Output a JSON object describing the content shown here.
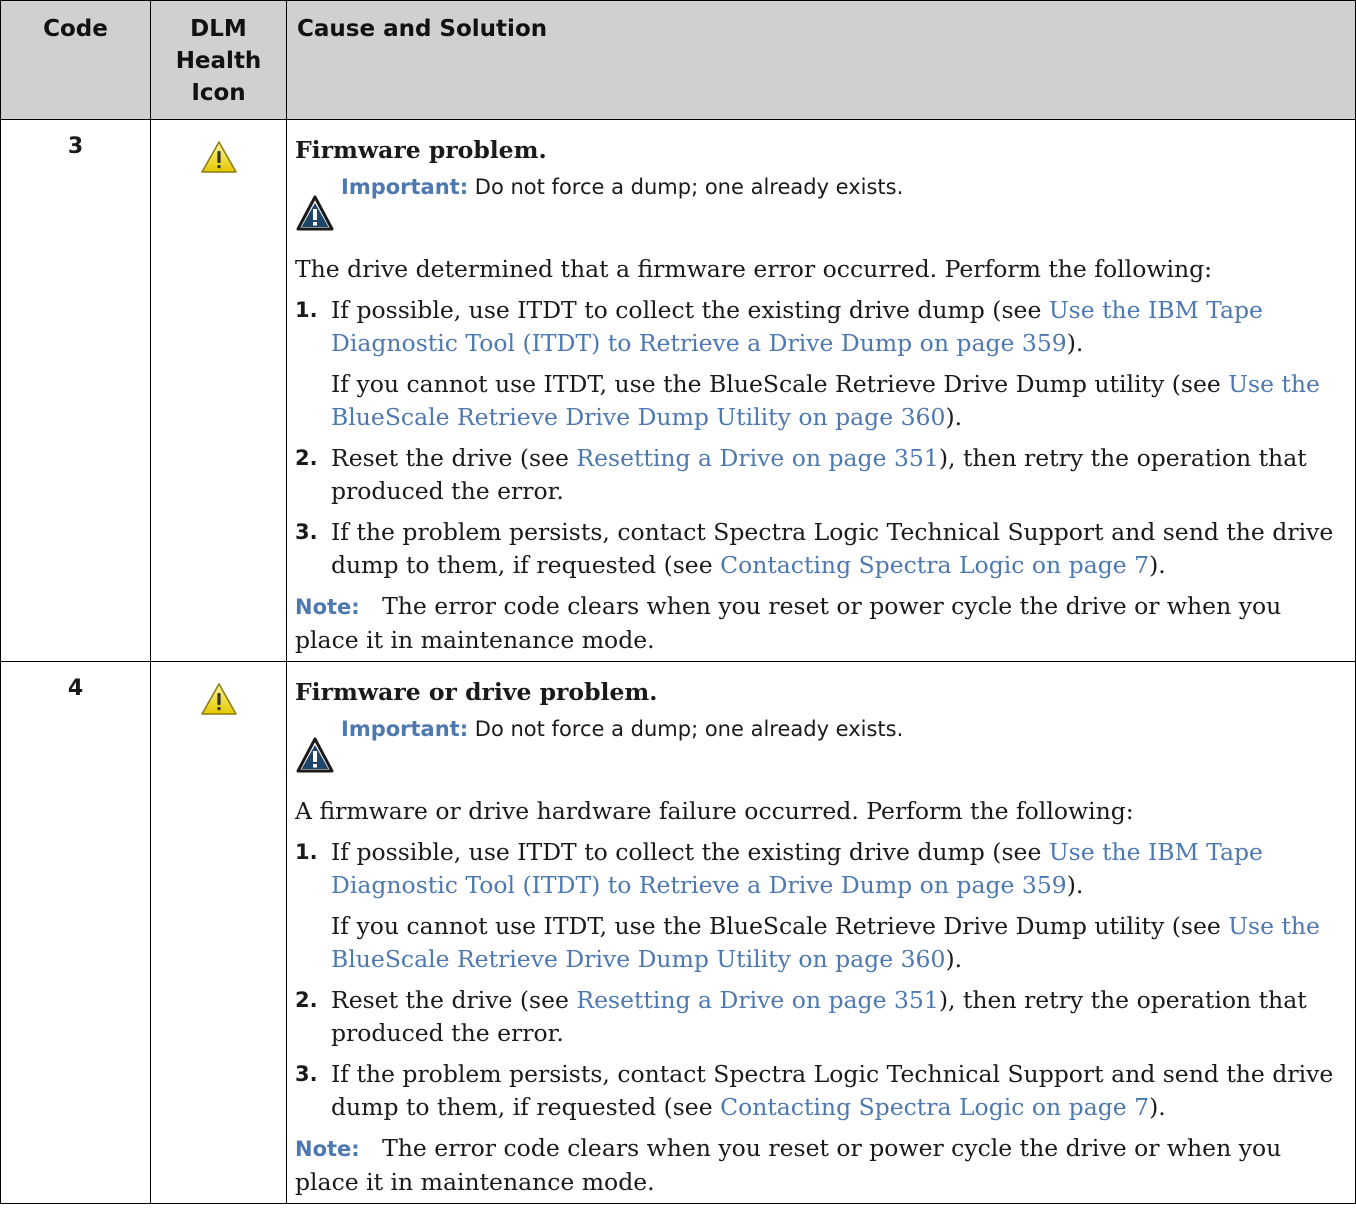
{
  "headers": {
    "code": "Code",
    "health_icon": "DLM Health Icon",
    "cause": "Cause and Solution"
  },
  "colors": {
    "header_bg": "#d0d0d0",
    "link": "#4d79b0",
    "warning_yellow": "#f2e14a"
  },
  "rows": [
    {
      "code": "3",
      "icon": "warning-triangle-icon",
      "title": "Firmware problem.",
      "important_label": "Important:",
      "important_text": " Do not force a dump; one already exists.",
      "intro": "The drive determined that a firmware error occurred. Perform the following:",
      "step1_num": "1.",
      "step1_text": "If possible, use ITDT to collect the existing drive dump (see ",
      "step1_link": "Use the IBM Tape Diagnostic Tool (ITDT) to Retrieve a Drive Dump on page 359",
      "step1_end": ").",
      "alt_text": "If you cannot use ITDT, use the BlueScale Retrieve Drive Dump utility (see ",
      "alt_link": "Use the BlueScale Retrieve Drive Dump Utility on page 360",
      "alt_end": ").",
      "step2_num": "2.",
      "step2_text": "Reset the drive (see ",
      "step2_link": "Resetting a Drive on page 351",
      "step2_end": "), then retry the operation that produced the error.",
      "step3_num": "3.",
      "step3_text": "If the problem persists, contact Spectra Logic Technical Support and send the drive dump to them, if requested (see ",
      "step3_link": "Contacting Spectra Logic on page 7",
      "step3_end": ").",
      "note_label": "Note:",
      "note_text": "   The error code clears when you reset or power cycle the drive or when you place it in maintenance mode."
    },
    {
      "code": "4",
      "icon": "warning-triangle-icon",
      "title": "Firmware or drive problem.",
      "important_label": "Important:",
      "important_text": " Do not force a dump; one already exists.",
      "intro": "A firmware or drive hardware failure occurred. Perform the following:",
      "step1_num": "1.",
      "step1_text": "If possible, use ITDT to collect the existing drive dump (see ",
      "step1_link": "Use the IBM Tape Diagnostic Tool (ITDT) to Retrieve a Drive Dump on page 359",
      "step1_end": ").",
      "alt_text": "If you cannot use ITDT, use the BlueScale Retrieve Drive Dump utility (see ",
      "alt_link": "Use the BlueScale Retrieve Drive Dump Utility on page 360",
      "alt_end": ").",
      "step2_num": "2.",
      "step2_text": "Reset the drive (see ",
      "step2_link": "Resetting a Drive on page 351",
      "step2_end": "), then retry the operation that produced the error.",
      "step3_num": "3.",
      "step3_text": "If the problem persists, contact Spectra Logic Technical Support and send the drive dump to them, if requested (see ",
      "step3_link": "Contacting Spectra Logic on page 7",
      "step3_end": ").",
      "note_label": "Note:",
      "note_text": "   The error code clears when you reset or power cycle the drive or when you place it in maintenance mode."
    }
  ]
}
